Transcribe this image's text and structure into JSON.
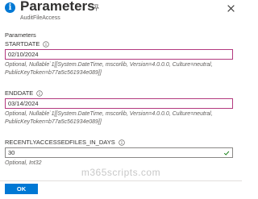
{
  "header": {
    "title": "Parameters",
    "subtitle": "AuditFileAccess",
    "info_icon_glyph": "i",
    "pin_icon": "pin-icon",
    "close_icon": "close-icon"
  },
  "section_label": "Parameters",
  "fields": [
    {
      "label": "STARTDATE",
      "value": "02/10/2024",
      "description": "Optional, Nullable`1[[System.DateTime, mscorlib, Version=4.0.0.0, Culture=neutral, PublicKeyToken=b77a5c561934e089]]",
      "state": "error"
    },
    {
      "label": "ENDDATE",
      "value": "03/14/2024",
      "description": "Optional, Nullable`1[[System.DateTime, mscorlib, Version=4.0.0.0, Culture=neutral, PublicKeyToken=b77a5c561934e089]]",
      "state": "error"
    },
    {
      "label": "RECENTLYACCESSEDFILES_IN_DAYS",
      "value": "30",
      "description": "Optional, Int32",
      "state": "valid"
    }
  ],
  "watermark": "m365scripts.com",
  "footer": {
    "ok_label": "OK"
  },
  "colors": {
    "accent": "#0078d4",
    "error_border": "#b33a7f",
    "valid_check": "#107c10"
  }
}
